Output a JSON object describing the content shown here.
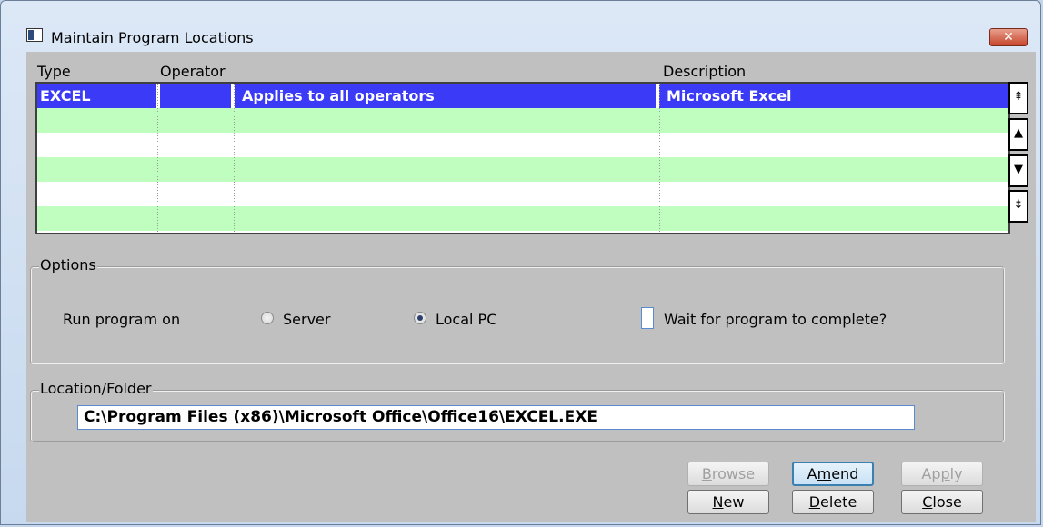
{
  "window": {
    "title": "Maintain Program Locations",
    "close_glyph": "✕"
  },
  "grid": {
    "columns": [
      "Type",
      "Operator",
      "Description"
    ],
    "rows": [
      {
        "type": "EXCEL",
        "operator": "",
        "applies": "Applies to all operators",
        "description": "Microsoft Excel",
        "selected": true
      }
    ],
    "scroll": {
      "top": "⇞",
      "up": "▲",
      "down": "▼",
      "bottom": "⇟"
    }
  },
  "options": {
    "legend": "Options",
    "run_label": "Run program on",
    "radio_server": "Server",
    "radio_local": "Local PC",
    "selected": "Local PC",
    "wait_label": "Wait for program to complete?",
    "wait_checked": false
  },
  "location": {
    "legend": "Location/Folder",
    "path": "C:\\Program Files (x86)\\Microsoft Office\\Office16\\EXCEL.EXE"
  },
  "buttons": {
    "browse": {
      "first": "B",
      "rest": "rowse"
    },
    "amend": {
      "pre": "A",
      "u": "m",
      "post": "end"
    },
    "apply": {
      "pre": "Ap",
      "u": "p",
      "post": "ly"
    },
    "new": {
      "u": "N",
      "post": "ew"
    },
    "delete": {
      "u": "D",
      "post": "elete"
    },
    "close": {
      "u": "C",
      "post": "lose"
    }
  },
  "colors": {
    "selection": "#3b3bf7",
    "row_alt": "#c0fec0",
    "close_button": "#c7452b"
  }
}
